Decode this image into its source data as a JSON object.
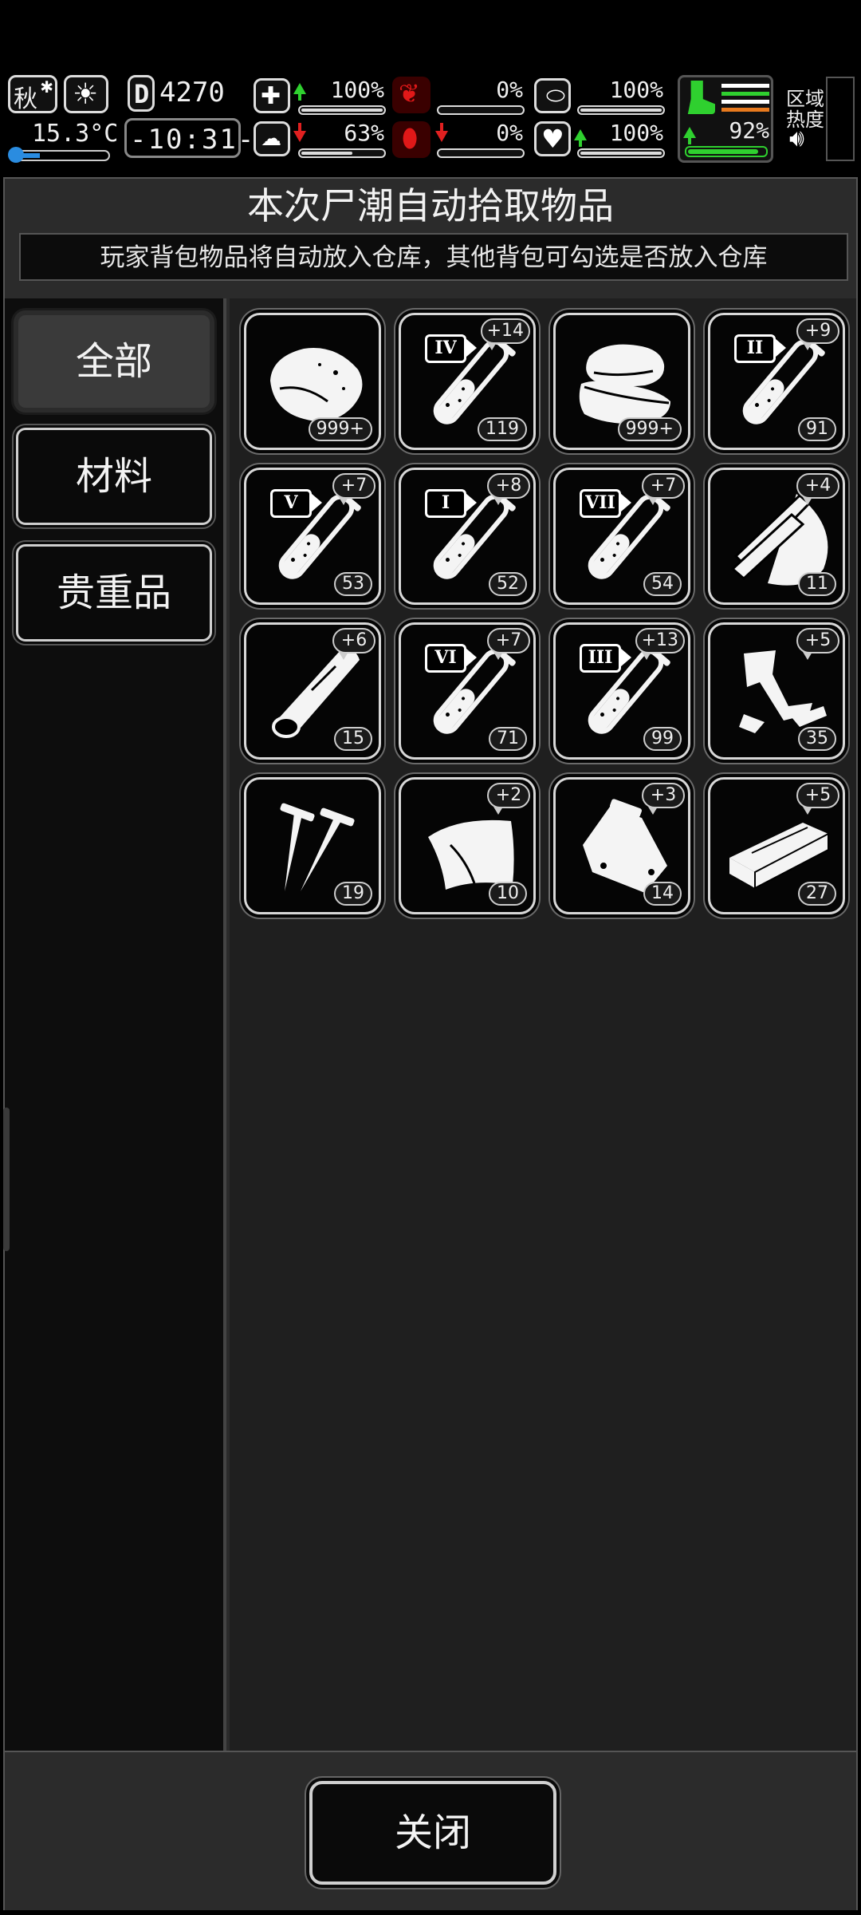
{
  "status": {
    "season": "秋",
    "temperature": "15.3°C",
    "day_counter": "4270",
    "day_prefix": "D",
    "clock": "-10:31-",
    "health_pct": "100%",
    "mind_pct": "63%",
    "hunger_pct": "0%",
    "blood_pct": "0%",
    "pill_pct": "100%",
    "heart_pct": "100%",
    "stamina_pct": "92%",
    "zone_heat_label_1": "区域",
    "zone_heat_label_2": "热度",
    "levels": {
      "health": 1.0,
      "mind": 0.63,
      "hunger": 0.0,
      "blood": 0.0,
      "pill": 1.0,
      "heart": 1.0,
      "stamina": 0.92
    }
  },
  "panel": {
    "title": "本次尸潮自动拾取物品",
    "subtitle": "玩家背包物品将自动放入仓库，其他背包可勾选是否放入仓库"
  },
  "categories": [
    {
      "label": "全部",
      "active": true
    },
    {
      "label": "材料",
      "active": false
    },
    {
      "label": "贵重品",
      "active": false
    }
  ],
  "items": [
    {
      "icon": "meat-chunk-icon",
      "count": "999+",
      "bonus": ""
    },
    {
      "icon": "test-tube-iv-icon",
      "count": "119",
      "bonus": "+14",
      "roman": "IV"
    },
    {
      "icon": "cloth-stack-icon",
      "count": "999+",
      "bonus": ""
    },
    {
      "icon": "test-tube-ii-icon",
      "count": "91",
      "bonus": "+9",
      "roman": "II"
    },
    {
      "icon": "test-tube-v-icon",
      "count": "53",
      "bonus": "+7",
      "roman": "V"
    },
    {
      "icon": "test-tube-i-icon",
      "count": "52",
      "bonus": "+8",
      "roman": "I"
    },
    {
      "icon": "test-tube-vii-icon",
      "count": "54",
      "bonus": "+7",
      "roman": "VII"
    },
    {
      "icon": "wood-planks-icon",
      "count": "11",
      "bonus": "+4"
    },
    {
      "icon": "log-icon",
      "count": "15",
      "bonus": "+6"
    },
    {
      "icon": "test-tube-vi-icon",
      "count": "71",
      "bonus": "+7",
      "roman": "VI"
    },
    {
      "icon": "test-tube-iii-icon",
      "count": "99",
      "bonus": "+13",
      "roman": "III"
    },
    {
      "icon": "scrap-metal-icon",
      "count": "35",
      "bonus": "+5"
    },
    {
      "icon": "nails-icon",
      "count": "19",
      "bonus": ""
    },
    {
      "icon": "leather-icon",
      "count": "10",
      "bonus": "+2"
    },
    {
      "icon": "plastic-bag-icon",
      "count": "14",
      "bonus": "+3"
    },
    {
      "icon": "wood-board-icon",
      "count": "27",
      "bonus": "+5"
    }
  ],
  "footer": {
    "close_label": "关闭"
  }
}
